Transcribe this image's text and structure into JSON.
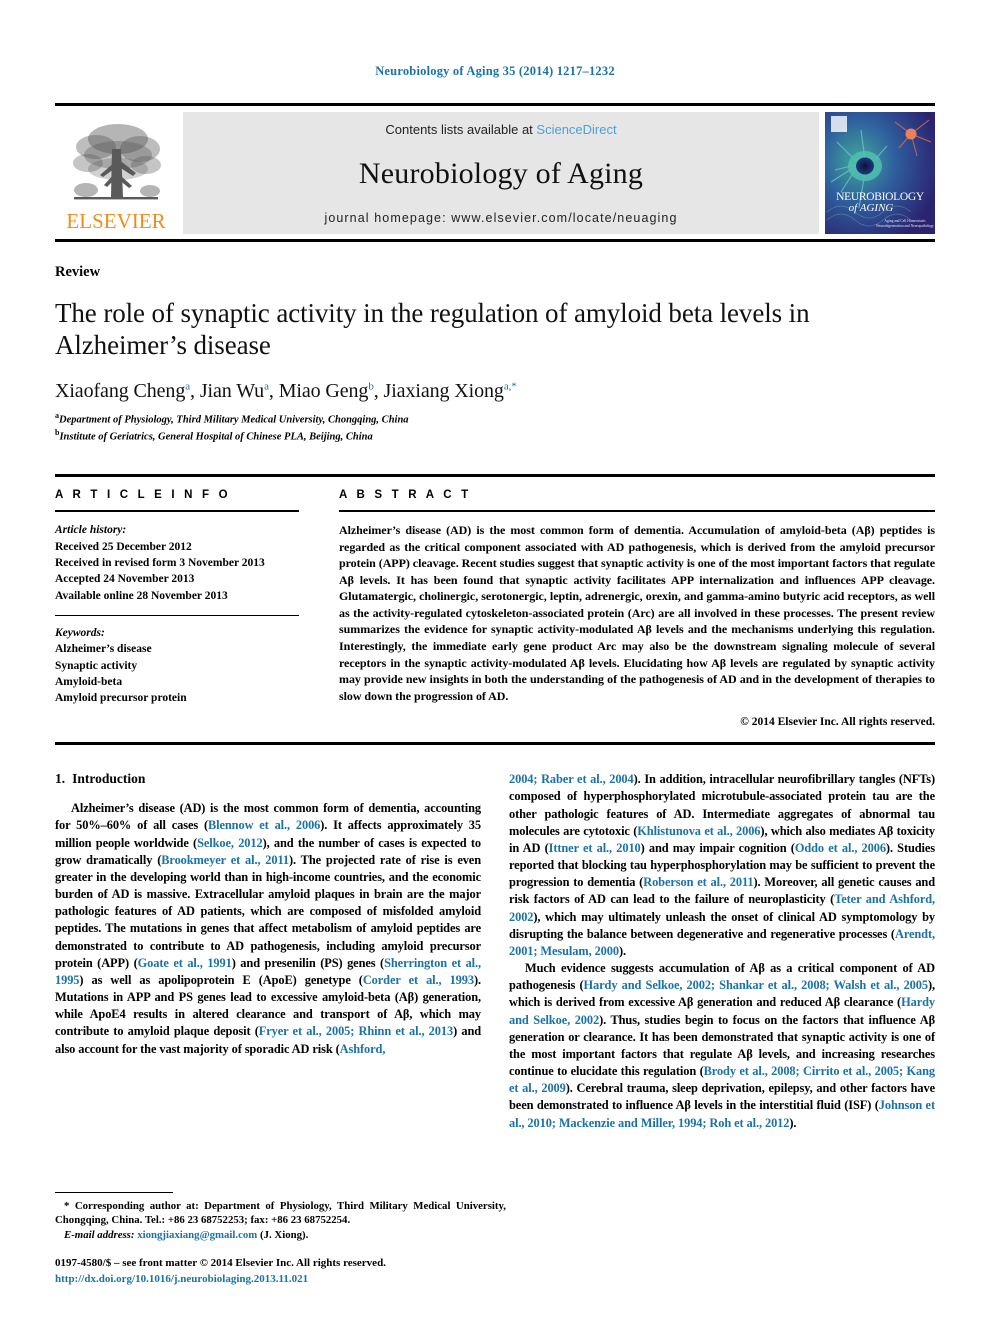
{
  "running_head": "Neurobiology of Aging 35 (2014) 1217–1232",
  "masthead": {
    "publisher_name": "ELSEVIER",
    "contents_prefix": "Contents lists available at ",
    "contents_link": "ScienceDirect",
    "journal_title": "Neurobiology of Aging",
    "homepage": "journal homepage: www.elsevier.com/locate/neuaging",
    "cover_title_line1": "NEUROBIOLOGY",
    "cover_title_line2": "of AGING",
    "cover_sub1": "Aging and Cell Homeostasis",
    "cover_sub2": "Neurodegeneration and Neuropathology"
  },
  "article": {
    "type": "Review",
    "title": "The role of synaptic activity in the regulation of amyloid beta levels in Alzheimer’s disease",
    "authors": [
      {
        "name": "Xiaofang Cheng",
        "sup": "a",
        "sep": ", "
      },
      {
        "name": "Jian Wu",
        "sup": "a",
        "sep": ", "
      },
      {
        "name": "Miao Geng",
        "sup": "b",
        "sep": ", "
      },
      {
        "name": "Jiaxiang Xiong",
        "sup": "a,*",
        "sep": ""
      }
    ],
    "affiliations": [
      {
        "sup": "a",
        "text": "Department of Physiology, Third Military Medical University, Chongqing, China"
      },
      {
        "sup": "b",
        "text": "Institute of Geriatrics, General Hospital of Chinese PLA, Beijing, China"
      }
    ]
  },
  "info": {
    "heading": "A R T I C L E   I N F O",
    "history_label": "Article history:",
    "history": [
      "Received 25 December 2012",
      "Received in revised form 3 November 2013",
      "Accepted 24 November 2013",
      "Available online 28 November 2013"
    ],
    "keywords_label": "Keywords:",
    "keywords": [
      "Alzheimer’s disease",
      "Synaptic activity",
      "Amyloid-beta",
      "Amyloid precursor protein"
    ]
  },
  "abstract": {
    "heading": "A B S T R A C T",
    "text": "Alzheimer’s disease (AD) is the most common form of dementia. Accumulation of amyloid-beta (Aβ) peptides is regarded as the critical component associated with AD pathogenesis, which is derived from the amyloid precursor protein (APP) cleavage. Recent studies suggest that synaptic activity is one of the most important factors that regulate Aβ levels. It has been found that synaptic activity facilitates APP internalization and influences APP cleavage. Glutamatergic, cholinergic, serotonergic, leptin, adrenergic, orexin, and gamma-amino butyric acid receptors, as well as the activity-regulated cytoskeleton-associated protein (Arc) are all involved in these processes. The present review summarizes the evidence for synaptic activity-modulated Aβ levels and the mechanisms underlying this regulation. Interestingly, the immediate early gene product Arc may also be the downstream signaling molecule of several receptors in the synaptic activity-modulated Aβ levels. Elucidating how Aβ levels are regulated by synaptic activity may provide new insights in both the understanding of the pathogenesis of AD and in the development of therapies to slow down the progression of AD.",
    "copyright": "© 2014 Elsevier Inc. All rights reserved."
  },
  "body": {
    "section_number": "1.",
    "section_title": "Introduction",
    "left_paragraphs": [
      [
        {
          "t": "Alzheimer’s disease (AD) is the most common form of dementia, accounting for 50%–60% of all cases ("
        },
        {
          "t": "Blennow et al., 2006",
          "cite": true
        },
        {
          "t": "). It affects approximately 35 million people worldwide ("
        },
        {
          "t": "Selkoe, 2012",
          "cite": true
        },
        {
          "t": "), and the number of cases is expected to grow dramatically ("
        },
        {
          "t": "Brookmeyer et al., 2011",
          "cite": true
        },
        {
          "t": "). The projected rate of rise is even greater in the developing world than in high-income countries, and the economic burden of AD is massive. Extracellular amyloid plaques in brain are the major pathologic features of AD patients, which are composed of misfolded amyloid peptides. The mutations in genes that affect metabolism of amyloid peptides are demonstrated to contribute to AD pathogenesis, including amyloid precursor protein (APP) ("
        },
        {
          "t": "Goate et al., 1991",
          "cite": true
        },
        {
          "t": ") and presenilin (PS) genes ("
        },
        {
          "t": "Sherrington et al., 1995",
          "cite": true
        },
        {
          "t": ") as well as apolipoprotein E (ApoE) genetype ("
        },
        {
          "t": "Corder et al., 1993",
          "cite": true
        },
        {
          "t": "). Mutations in APP and PS genes lead to excessive amyloid-beta (Aβ) generation, while ApoE4 results in altered clearance and transport of Aβ, which may contribute to amyloid plaque deposit ("
        },
        {
          "t": "Fryer et al., 2005; Rhinn et al., 2013",
          "cite": true
        },
        {
          "t": ") and also account for the vast majority of sporadic AD risk ("
        },
        {
          "t": "Ashford,",
          "cite": true
        }
      ]
    ],
    "right_paragraphs": [
      [
        {
          "t": "2004; Raber et al., 2004",
          "cite": true
        },
        {
          "t": "). In addition, intracellular neurofibrillary tangles (NFTs) composed of hyperphosphorylated microtubule-associated protein tau are the other pathologic features of AD. Intermediate aggregates of abnormal tau molecules are cytotoxic ("
        },
        {
          "t": "Khlistunova et al., 2006",
          "cite": true
        },
        {
          "t": "), which also mediates Aβ toxicity in AD ("
        },
        {
          "t": "Ittner et al., 2010",
          "cite": true
        },
        {
          "t": ") and may impair cognition ("
        },
        {
          "t": "Oddo et al., 2006",
          "cite": true
        },
        {
          "t": "). Studies reported that blocking tau hyperphosphorylation may be sufficient to prevent the progression to dementia ("
        },
        {
          "t": "Roberson et al., 2011",
          "cite": true
        },
        {
          "t": "). Moreover, all genetic causes and risk factors of AD can lead to the failure of neuroplasticity ("
        },
        {
          "t": "Teter and Ashford, 2002",
          "cite": true
        },
        {
          "t": "), which may ultimately unleash the onset of clinical AD symptomology by disrupting the balance between degenerative and regenerative processes ("
        },
        {
          "t": "Arendt, 2001; Mesulam, 2000",
          "cite": true
        },
        {
          "t": ")."
        }
      ],
      [
        {
          "t": "Much evidence suggests accumulation of Aβ as a critical component of AD pathogenesis ("
        },
        {
          "t": "Hardy and Selkoe, 2002; Shankar et al., 2008; Walsh et al., 2005",
          "cite": true
        },
        {
          "t": "), which is derived from excessive Aβ generation and reduced Aβ clearance ("
        },
        {
          "t": "Hardy and Selkoe, 2002",
          "cite": true
        },
        {
          "t": "). Thus, studies begin to focus on the factors that influence Aβ generation or clearance. It has been demonstrated that synaptic activity is one of the most important factors that regulate Aβ levels, and increasing researches continue to elucidate this regulation ("
        },
        {
          "t": "Brody et al., 2008; Cirrito et al., 2005; Kang et al., 2009",
          "cite": true
        },
        {
          "t": "). Cerebral trauma, sleep deprivation, epilepsy, and other factors have been demonstrated to influence Aβ levels in the interstitial fluid (ISF) ("
        },
        {
          "t": "Johnson et al., 2010; Mackenzie and Miller, 1994; Roh et al., 2012",
          "cite": true
        },
        {
          "t": ")."
        }
      ]
    ]
  },
  "footnote": {
    "corresponding": "* Corresponding author at: Department of Physiology, Third Military Medical University, Chongqing, China. Tel.: +86 23 68752253; fax: +86 23 68752254.",
    "email_label": "E-mail address:",
    "email": "xiongjiaxiang@gmail.com",
    "email_suffix": "(J. Xiong).",
    "issn": "0197-4580/$ – see front matter © 2014 Elsevier Inc. All rights reserved.",
    "doi": "http://dx.doi.org/10.1016/j.neurobiolaging.2013.11.021"
  },
  "colors": {
    "link": "#1a72a8",
    "sciencedirect": "#4aa3d6",
    "elsevier_orange": "#F08C1E"
  }
}
